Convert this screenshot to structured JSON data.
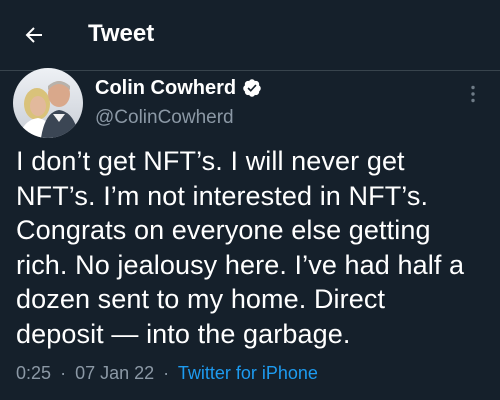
{
  "header": {
    "title": "Tweet",
    "back_icon": "arrow-left-icon"
  },
  "tweet": {
    "author": {
      "name": "Colin Cowherd",
      "handle": "@ColinCowherd",
      "verified_icon": "verified-badge-icon"
    },
    "text": "I don’t get NFT’s. I will never get\nNFT’s. I’m not interested in NFT’s.\nCongrats on everyone else getting\nrich. No jealousy here. I’ve had half a\ndozen sent to my home. Direct\ndeposit — into the garbage.",
    "time": "0:25",
    "date": "07 Jan 22",
    "separator": "·",
    "source": "Twitter for iPhone",
    "more_icon": "more-vertical-icon"
  },
  "colors": {
    "background": "#15202b",
    "text": "#ffffff",
    "secondary_text": "#8b98a5",
    "accent": "#1d9bf0",
    "divider": "#38444d"
  }
}
